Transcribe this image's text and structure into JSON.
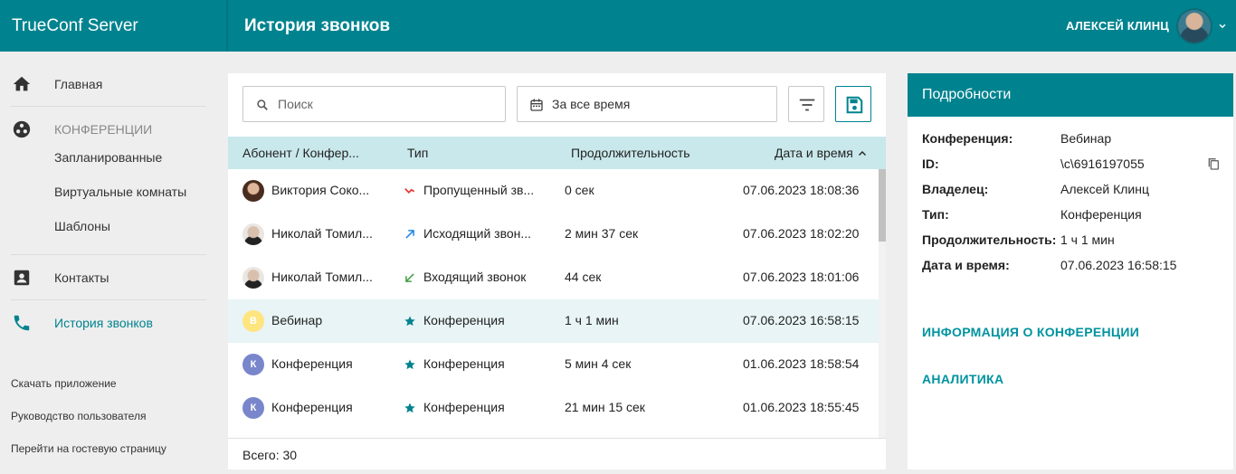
{
  "app": {
    "brand": "TrueConf Server"
  },
  "header": {
    "title": "История звонков",
    "user_name": "АЛЕКСЕЙ КЛИНЦ"
  },
  "sidebar": {
    "home": "Главная",
    "conferences_header": "КОНФЕРЕНЦИИ",
    "conference_items": [
      "Запланированные",
      "Виртуальные комнаты",
      "Шаблоны"
    ],
    "contacts": "Контакты",
    "call_history": "История звонков",
    "footer_links": [
      "Скачать приложение",
      "Руководство пользователя",
      "Перейти на гостевую страницу"
    ]
  },
  "toolbar": {
    "search_placeholder": "Поиск",
    "period": "За все время"
  },
  "table": {
    "columns": [
      "Абонент / Конфер...",
      "Тип",
      "Продолжительность",
      "Дата и время"
    ],
    "rows": [
      {
        "avatar": "photo",
        "initial": "",
        "name": "Виктория Соко...",
        "type_icon": "missed-call-icon",
        "type": "Пропущенный зв...",
        "duration": "0 сек",
        "datetime": "07.06.2023 18:08:36"
      },
      {
        "avatar": "photo",
        "initial": "",
        "name": "Николай Томил...",
        "type_icon": "outgoing-call-icon",
        "type": "Исходящий звон...",
        "duration": "2 мин 37 сек",
        "datetime": "07.06.2023 18:02:20"
      },
      {
        "avatar": "photo",
        "initial": "",
        "name": "Николай Томил...",
        "type_icon": "incoming-call-icon",
        "type": "Входящий звонок",
        "duration": "44 сек",
        "datetime": "07.06.2023 18:01:06"
      },
      {
        "avatar": "initial",
        "initial": "В",
        "name": "Вебинар",
        "type_icon": "star-icon",
        "type": "Конференция",
        "duration": "1 ч 1 мин",
        "datetime": "07.06.2023 16:58:15"
      },
      {
        "avatar": "initial",
        "initial": "К",
        "name": "Конференция",
        "type_icon": "star-icon",
        "type": "Конференция",
        "duration": "5 мин 4 сек",
        "datetime": "01.06.2023 18:58:54"
      },
      {
        "avatar": "initial",
        "initial": "К",
        "name": "Конференция",
        "type_icon": "star-icon",
        "type": "Конференция",
        "duration": "21 мин 15 сек",
        "datetime": "01.06.2023 18:55:45"
      }
    ],
    "total": "Всего: 30"
  },
  "details": {
    "title": "Подробности",
    "fields": [
      {
        "label": "Конференция:",
        "value": "Вебинар"
      },
      {
        "label": "ID:",
        "value": "\\c\\6916197055"
      },
      {
        "label": "Владелец:",
        "value": "Алексей Клинц"
      },
      {
        "label": "Тип:",
        "value": "Конференция"
      },
      {
        "label": "Продолжительность:",
        "value": "1 ч 1 мин"
      },
      {
        "label": "Дата и время:",
        "value": "07.06.2023 16:58:15"
      }
    ],
    "link_info": "ИНФОРМАЦИЯ О КОНФЕРЕНЦИИ",
    "link_analytics": "АНАЛИТИКА"
  },
  "colors": {
    "primary": "#00838f",
    "header_row": "#c9e8eb",
    "selected_row": "#e8f4f5",
    "link": "#00939f"
  }
}
